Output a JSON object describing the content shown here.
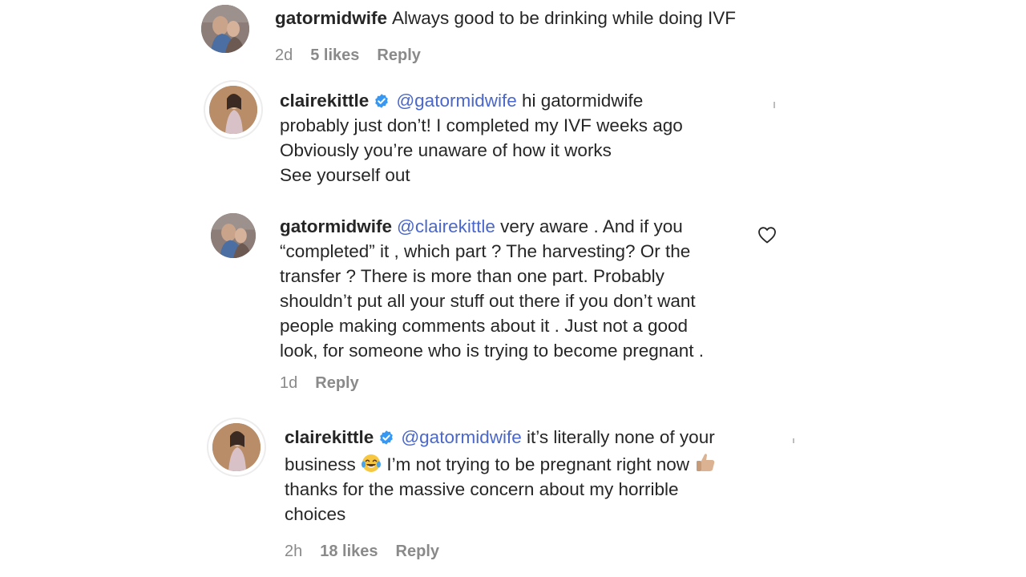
{
  "comments": [
    {
      "username": "gatormidwife",
      "verified": false,
      "lines": [
        "Always good to be drinking while doing IVF"
      ],
      "time": "2d",
      "likes": "5 likes",
      "reply": "Reply"
    },
    {
      "username": "clairekittle",
      "verified": true,
      "mention": "@gatormidwife",
      "first_line_rest": "hi gatormidwife",
      "lines": [
        "probably just don’t! I completed my IVF weeks ago",
        "Obviously you’re unaware of how it works",
        "See yourself out"
      ]
    },
    {
      "username": "gatormidwife",
      "verified": false,
      "mention": "@clairekittle",
      "first_line_rest": "very aware . And if you",
      "lines": [
        "“completed” it , which part ? The harvesting? Or the",
        "transfer ? There is more than one part. Probably",
        "shouldn’t put all your stuff out there if you don’t want",
        "people making comments about it . Just not a good",
        "look, for someone who is trying to become pregnant ."
      ],
      "time": "1d",
      "reply": "Reply"
    },
    {
      "username": "clairekittle",
      "verified": true,
      "mention": "@gatormidwife",
      "first_line_rest": "it’s literally none of your",
      "line2_before_emoji": "business",
      "line2_after_emoji": "I’m not trying to be pregnant right now",
      "lines": [
        "thanks for the massive concern about my horrible",
        "choices"
      ],
      "time": "2h",
      "likes": "18 likes",
      "reply": "Reply"
    }
  ],
  "icons": {
    "heart": "heart-outline-icon",
    "verified": "verified-badge-icon",
    "laughing": "face-with-tears-of-joy-emoji",
    "thumbs_up": "thumbs-up-emoji"
  },
  "colors": {
    "mention": "#4a67c9",
    "verified": "#3897f0",
    "meta": "#8a8a8a"
  }
}
